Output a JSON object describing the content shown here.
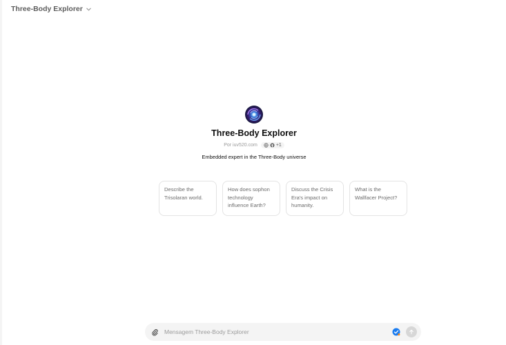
{
  "header": {
    "title": "Three-Body Explorer"
  },
  "gpt": {
    "name": "Three-Body Explorer",
    "author": "Por iuv520.com",
    "capabilities_extra": "+1",
    "description": "Embedded expert in the Three-Body universe"
  },
  "starters": [
    {
      "text": "Describe the Trisolaran world."
    },
    {
      "text": "How does sophon technology influence Earth?"
    },
    {
      "text": "Discuss the Crisis Era's impact on humanity."
    },
    {
      "text": "What is the Wallfacer Project?"
    }
  ],
  "composer": {
    "placeholder": "Mensagem Three-Body Explorer"
  },
  "icons": {
    "header_chevron": "chevron-down-icon",
    "web": "globe-icon",
    "code": "github-icon",
    "attach": "paperclip-icon",
    "tool": "checkmark-badge-icon",
    "send": "arrow-up-icon"
  },
  "colors": {
    "accent_blue": "#1a7cf0",
    "send_disabled": "#d7d7d7"
  }
}
